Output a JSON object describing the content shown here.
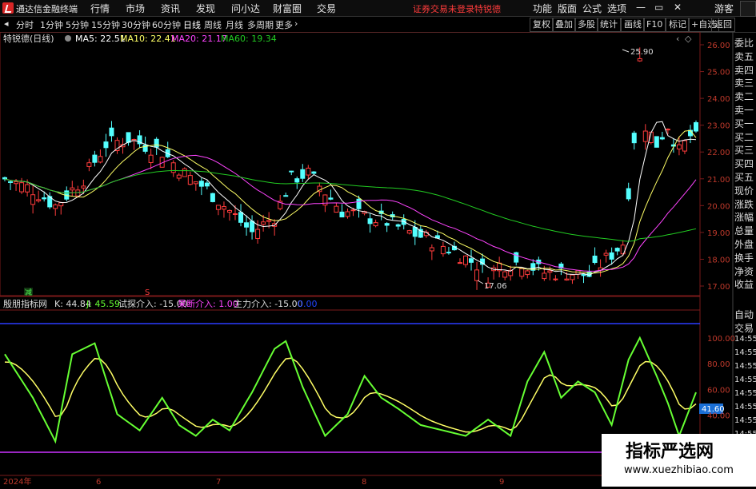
{
  "app": {
    "title": "通达信金融终端"
  },
  "menu": [
    "行情",
    "市场",
    "资讯",
    "发现",
    "问小达",
    "财富圈",
    "交易"
  ],
  "notice": "证券交易未登录",
  "stock_name_top": "特锐德",
  "right_menu": [
    "功能",
    "版面",
    "公式",
    "选项"
  ],
  "window": {
    "guest": "游客"
  },
  "toolbar": {
    "periods": [
      "分时",
      "1分钟",
      "5分钟",
      "15分钟",
      "30分钟",
      "60分钟",
      "日线",
      "周线",
      "月线",
      "多周期",
      "更多"
    ],
    "active": "日线",
    "right_buttons": [
      "复权",
      "叠加",
      "多股",
      "统计",
      "画线",
      "F10",
      "标记",
      "+自选",
      "返回"
    ]
  },
  "main_legend": {
    "title": "特锐德(日线)",
    "ma5": "MA5: 22.51",
    "ma10": "MA10: 22.41",
    "ma20": "MA20: 21.17",
    "ma60": "MA60: 19.34"
  },
  "sub_legend": {
    "title": "殷朋指标网",
    "k": "K: 44.84",
    "j": "J: 45.59",
    "s1": "试探介入: -15.00",
    "s2": "果断介入: 1.00",
    "s3": "主力介入: -15.00",
    "s4": "0.00"
  },
  "annotations": {
    "high": "25.90",
    "low": "17.06",
    "jian": "减",
    "s": "S"
  },
  "right_panel": [
    "委比",
    "卖五",
    "卖四",
    "卖三",
    "卖二",
    "卖一",
    "买一",
    "买二",
    "买三",
    "买四",
    "买五",
    "现价",
    "涨跌",
    "涨幅",
    "总量",
    "外盘",
    "换手",
    "净资",
    "收益"
  ],
  "right_panel2": [
    "自动",
    "交易",
    "14:55",
    "14:55",
    "14:55",
    "14:55",
    "14:55",
    "14:55",
    "14:55",
    "14:55"
  ],
  "price_axis": [
    "26.00",
    "25.00",
    "24.00",
    "23.00",
    "22.00",
    "21.00",
    "20.00",
    "19.00",
    "18.00",
    "17.00"
  ],
  "sub_axis": [
    "100.00",
    "80.00",
    "60.00",
    "40.00",
    "20.00"
  ],
  "current_value_tag": "41.60",
  "x_axis": [
    "2024年",
    "6",
    "7",
    "8",
    "9"
  ],
  "watermark": {
    "line1": "指标严选网",
    "line2": "www.xuezhibiao.com"
  },
  "colors": {
    "up": "#ff3c3c",
    "down": "#54ffff",
    "ma5": "#ffffff",
    "ma10": "#ffff66",
    "ma20": "#ff44ff",
    "ma60": "#22cc22",
    "k": "#ffff66",
    "j": "#66ff33"
  }
}
